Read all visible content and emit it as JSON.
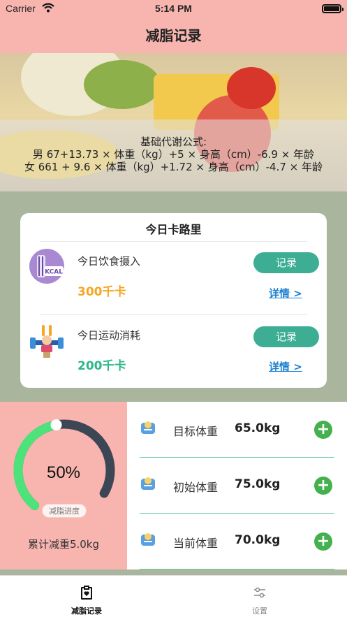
{
  "status_bar": {
    "carrier": "Carrier",
    "time": "5:14 PM"
  },
  "nav": {
    "title": "减脂记录"
  },
  "formula": {
    "title": "基础代谢公式:",
    "male": "男 67+13.73 × 体重（kg）+5 × 身高（cm）-6.9 × 年龄",
    "female": "女 661 + 9.6 × 体重（kg）+1.72 × 身高（cm）-4.7 × 年龄"
  },
  "calories_card": {
    "title": "今日卡路里",
    "intake": {
      "label": "今日饮食摄入",
      "value": "300千卡",
      "record_button": "记录",
      "detail_link": "详情 >",
      "icon_text": "KCAL",
      "color": "#f5a623"
    },
    "burn": {
      "label": "今日运动消耗",
      "value": "200千卡",
      "record_button": "记录",
      "detail_link": "详情 >",
      "color": "#2cb888"
    }
  },
  "progress": {
    "percent_text": "50%",
    "percent": 0.5,
    "badge": "减脂进度",
    "cumulative": "累计减重5.0kg"
  },
  "weights": [
    {
      "label": "目标体重",
      "value": "65.0kg",
      "add": "+"
    },
    {
      "label": "初始体重",
      "value": "75.0kg",
      "add": "+"
    },
    {
      "label": "当前体重",
      "value": "70.0kg",
      "add": "+"
    }
  ],
  "tabs": [
    {
      "label": "减脂记录",
      "icon": "clipboard-heart-icon",
      "active": true
    },
    {
      "label": "设置",
      "icon": "sliders-icon",
      "active": false
    }
  ],
  "colors": {
    "nav_bg": "#f8b5b0",
    "accent_green": "#3dae94",
    "gauge_green": "#4ee37a",
    "gauge_track": "#3d4655",
    "add_green": "#45b04e"
  }
}
